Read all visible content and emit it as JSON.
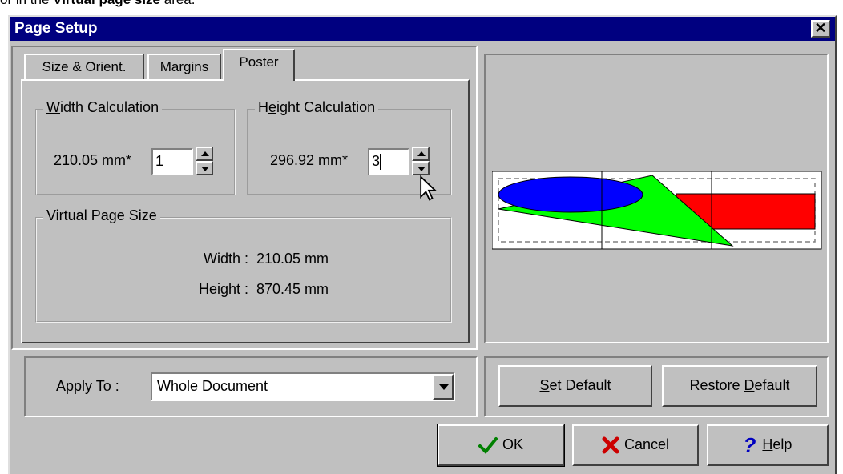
{
  "caption": {
    "prefix": "or in the ",
    "bold": "Virtual page size",
    "suffix": " area."
  },
  "window": {
    "title": "Page Setup",
    "close_icon": "close-icon"
  },
  "tabs": [
    {
      "label": "Size & Orient."
    },
    {
      "label": "Margins"
    },
    {
      "label": "Poster",
      "active": true
    }
  ],
  "width_calc": {
    "legend_u": "W",
    "legend_rest": "idth Calculation",
    "value_label": "210.05 mm*",
    "input_value": "1"
  },
  "height_calc": {
    "legend_pre": "H",
    "legend_u": "e",
    "legend_rest": "ight Calculation",
    "value_label": "296.92 mm*",
    "input_value": "3"
  },
  "virtual": {
    "legend": "Virtual Page Size",
    "width_label": "Width :",
    "width_value": "210.05 mm",
    "height_label": "Height :",
    "height_value": "870.45 mm"
  },
  "apply": {
    "label_u": "A",
    "label_rest": "pply To :",
    "value": "Whole Document"
  },
  "buttons": {
    "set_default_u": "S",
    "set_default_rest": "et Default",
    "restore_pre": "Restore ",
    "restore_u": "D",
    "restore_rest": "efault",
    "ok": "OK",
    "cancel": "Cancel",
    "help_u": "H",
    "help_rest": "elp"
  },
  "preview": {
    "colors": {
      "ellipse": "#0000ff",
      "triangle": "#00ff00",
      "rect": "#ff0000"
    }
  }
}
